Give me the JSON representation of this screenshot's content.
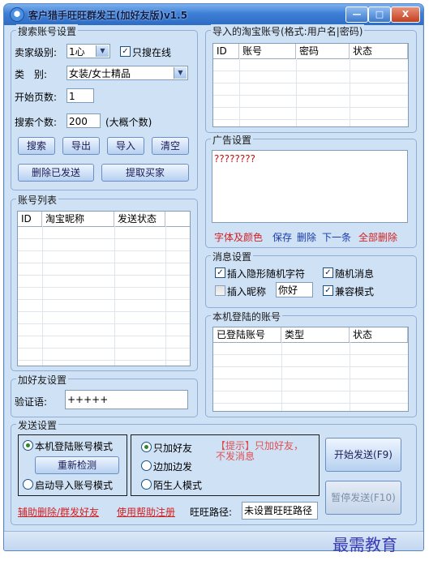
{
  "window": {
    "title": "客户猎手旺旺群发王(加好友版)v1.5",
    "buttons": {
      "minimize": "—",
      "maximize": "□",
      "close": "X"
    }
  },
  "search_settings": {
    "title": "搜索账号设置",
    "seller_level_label": "卖家级别:",
    "seller_level_value": "1心",
    "only_online_label": "只搜在线",
    "only_online_checked": true,
    "category_label": "类　别:",
    "category_value": "女装/女士精品",
    "start_page_label": "开始页数:",
    "start_page_value": "1",
    "search_count_label": "搜索个数:",
    "search_count_value": "200",
    "search_count_hint": "(大概个数)",
    "buttons": {
      "search": "搜索",
      "export": "导出",
      "import": "导入",
      "clear": "清空",
      "delete_sent": "删除已发送",
      "extract_buyers": "提取买家"
    }
  },
  "account_list": {
    "title": "账号列表",
    "columns": [
      "ID",
      "淘宝昵称",
      "发送状态"
    ]
  },
  "add_friend": {
    "title": "加好友设置",
    "verify_label": "验证语:",
    "verify_value": "+++++"
  },
  "imported_accounts": {
    "title": "导入的淘宝账号(格式:用户名|密码)",
    "columns": [
      "ID",
      "账号",
      "密码",
      "状态"
    ]
  },
  "ad_settings": {
    "title": "广告设置",
    "text": "????????",
    "links": {
      "font_color": "字体及颜色",
      "save": "保存",
      "delete": "删除",
      "next": "下一条",
      "delete_all": "全部删除"
    }
  },
  "message_settings": {
    "title": "消息设置",
    "insert_hidden_chars": "插入隐形随机字符",
    "random_message": "随机消息",
    "insert_nickname": "插入昵称",
    "nickname_value": "你好",
    "compatible_mode": "兼容模式"
  },
  "local_accounts": {
    "title": "本机登陆的账号",
    "columns": [
      "已登陆账号",
      "类型",
      "状态"
    ]
  },
  "send_settings": {
    "title": "发送设置",
    "local_mode": "本机登陆账号模式",
    "recheck": "重新检测",
    "import_mode": "启动导入账号模式",
    "only_add_friend": "只加好友",
    "add_and_send": "边加边发",
    "stranger_mode": "陌生人模式",
    "tip": "【提示】只加好友，不发消息",
    "start_send": "开始发送(F9)",
    "pause_send": "暂停发送(F10)"
  },
  "bottom": {
    "helper_link": "辅助删除/群发好友",
    "help_link": "使用帮助注册",
    "ww_path_label": "旺旺路径:",
    "ww_path_value": "未设置旺旺路径"
  },
  "watermark": "最需教育",
  "colors": {
    "title_bar": "#3d7fd6",
    "panel": "#cfe1f5",
    "link_red": "#d42020",
    "link_blue": "#1b3ba8",
    "tip_red": "#e05050"
  }
}
